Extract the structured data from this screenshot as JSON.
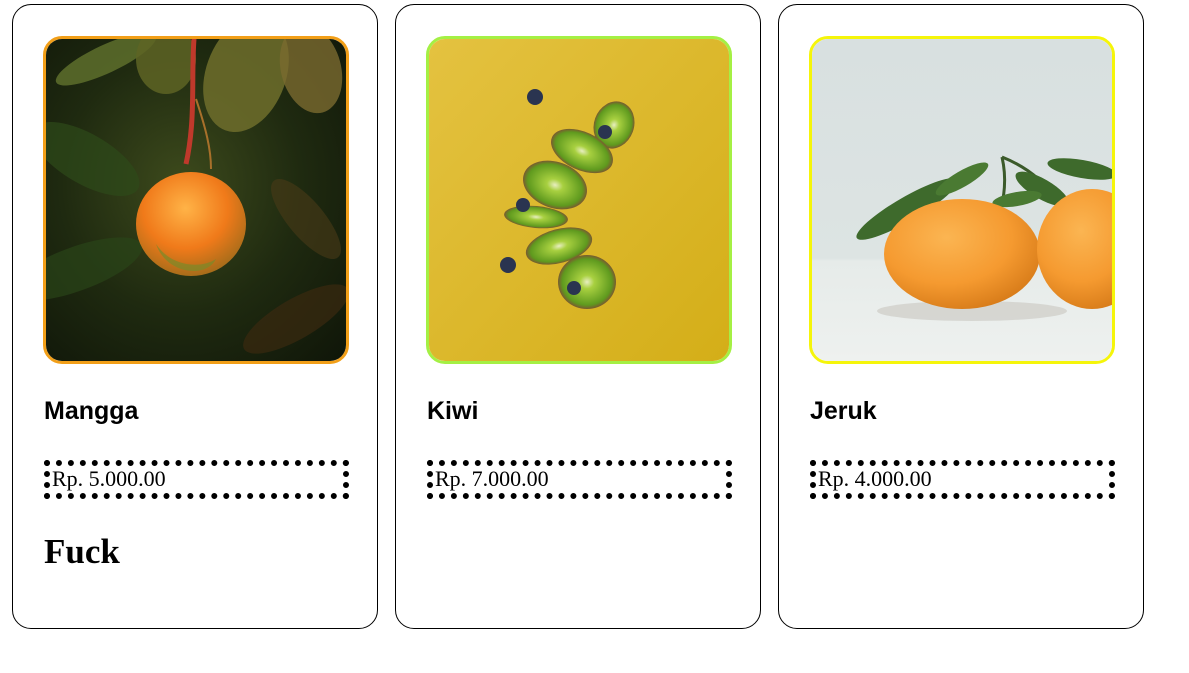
{
  "products": [
    {
      "name": "Mangga",
      "price": "Rp. 5.000.00",
      "extra": "Fuck",
      "border_color": "#f29f18",
      "image": "mango-photo"
    },
    {
      "name": "Kiwi",
      "price": "Rp. 7.000.00",
      "border_color": "#a4f044",
      "image": "kiwi-photo"
    },
    {
      "name": "Jeruk",
      "price": "Rp. 4.000.00",
      "border_color": "#f5f50a",
      "image": "orange-photo"
    }
  ]
}
